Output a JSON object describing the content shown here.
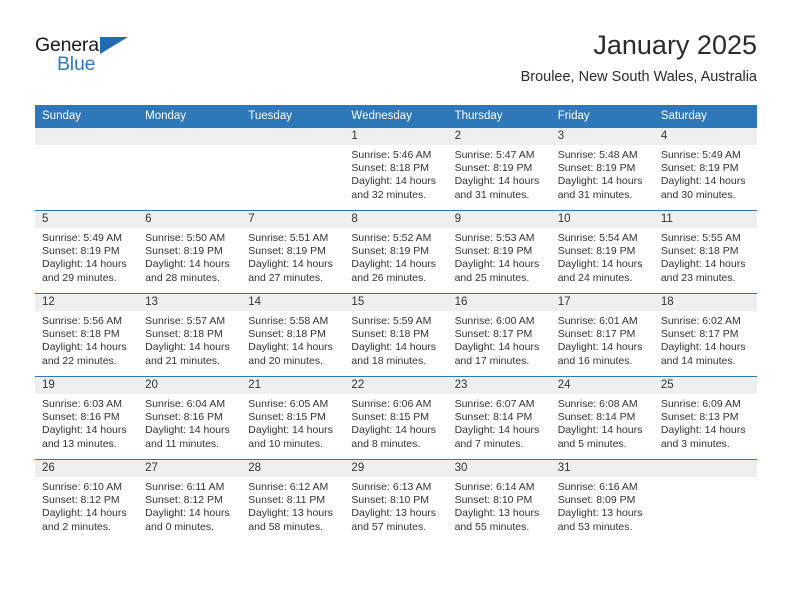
{
  "brand": {
    "name_part1": "General",
    "name_part2": "Blue",
    "triangle_color": "#1f6cb0",
    "blue_text_color": "#2e7ac4"
  },
  "header": {
    "title": "January 2025",
    "location": "Broulee, New South Wales, Australia"
  },
  "theme": {
    "header_blue": "#2e77b8",
    "daynum_band_gray": "#efefef",
    "text_color": "#333333"
  },
  "calendar": {
    "weekday_headers": [
      "Sunday",
      "Monday",
      "Tuesday",
      "Wednesday",
      "Thursday",
      "Friday",
      "Saturday"
    ],
    "weeks": [
      [
        {
          "empty": true
        },
        {
          "empty": true
        },
        {
          "empty": true
        },
        {
          "day": "1",
          "sunrise": "Sunrise: 5:46 AM",
          "sunset": "Sunset: 8:18 PM",
          "daylight": "Daylight: 14 hours and 32 minutes."
        },
        {
          "day": "2",
          "sunrise": "Sunrise: 5:47 AM",
          "sunset": "Sunset: 8:19 PM",
          "daylight": "Daylight: 14 hours and 31 minutes."
        },
        {
          "day": "3",
          "sunrise": "Sunrise: 5:48 AM",
          "sunset": "Sunset: 8:19 PM",
          "daylight": "Daylight: 14 hours and 31 minutes."
        },
        {
          "day": "4",
          "sunrise": "Sunrise: 5:49 AM",
          "sunset": "Sunset: 8:19 PM",
          "daylight": "Daylight: 14 hours and 30 minutes."
        }
      ],
      [
        {
          "day": "5",
          "sunrise": "Sunrise: 5:49 AM",
          "sunset": "Sunset: 8:19 PM",
          "daylight": "Daylight: 14 hours and 29 minutes."
        },
        {
          "day": "6",
          "sunrise": "Sunrise: 5:50 AM",
          "sunset": "Sunset: 8:19 PM",
          "daylight": "Daylight: 14 hours and 28 minutes."
        },
        {
          "day": "7",
          "sunrise": "Sunrise: 5:51 AM",
          "sunset": "Sunset: 8:19 PM",
          "daylight": "Daylight: 14 hours and 27 minutes."
        },
        {
          "day": "8",
          "sunrise": "Sunrise: 5:52 AM",
          "sunset": "Sunset: 8:19 PM",
          "daylight": "Daylight: 14 hours and 26 minutes."
        },
        {
          "day": "9",
          "sunrise": "Sunrise: 5:53 AM",
          "sunset": "Sunset: 8:19 PM",
          "daylight": "Daylight: 14 hours and 25 minutes."
        },
        {
          "day": "10",
          "sunrise": "Sunrise: 5:54 AM",
          "sunset": "Sunset: 8:19 PM",
          "daylight": "Daylight: 14 hours and 24 minutes."
        },
        {
          "day": "11",
          "sunrise": "Sunrise: 5:55 AM",
          "sunset": "Sunset: 8:18 PM",
          "daylight": "Daylight: 14 hours and 23 minutes."
        }
      ],
      [
        {
          "day": "12",
          "sunrise": "Sunrise: 5:56 AM",
          "sunset": "Sunset: 8:18 PM",
          "daylight": "Daylight: 14 hours and 22 minutes."
        },
        {
          "day": "13",
          "sunrise": "Sunrise: 5:57 AM",
          "sunset": "Sunset: 8:18 PM",
          "daylight": "Daylight: 14 hours and 21 minutes."
        },
        {
          "day": "14",
          "sunrise": "Sunrise: 5:58 AM",
          "sunset": "Sunset: 8:18 PM",
          "daylight": "Daylight: 14 hours and 20 minutes."
        },
        {
          "day": "15",
          "sunrise": "Sunrise: 5:59 AM",
          "sunset": "Sunset: 8:18 PM",
          "daylight": "Daylight: 14 hours and 18 minutes."
        },
        {
          "day": "16",
          "sunrise": "Sunrise: 6:00 AM",
          "sunset": "Sunset: 8:17 PM",
          "daylight": "Daylight: 14 hours and 17 minutes."
        },
        {
          "day": "17",
          "sunrise": "Sunrise: 6:01 AM",
          "sunset": "Sunset: 8:17 PM",
          "daylight": "Daylight: 14 hours and 16 minutes."
        },
        {
          "day": "18",
          "sunrise": "Sunrise: 6:02 AM",
          "sunset": "Sunset: 8:17 PM",
          "daylight": "Daylight: 14 hours and 14 minutes."
        }
      ],
      [
        {
          "day": "19",
          "sunrise": "Sunrise: 6:03 AM",
          "sunset": "Sunset: 8:16 PM",
          "daylight": "Daylight: 14 hours and 13 minutes."
        },
        {
          "day": "20",
          "sunrise": "Sunrise: 6:04 AM",
          "sunset": "Sunset: 8:16 PM",
          "daylight": "Daylight: 14 hours and 11 minutes."
        },
        {
          "day": "21",
          "sunrise": "Sunrise: 6:05 AM",
          "sunset": "Sunset: 8:15 PM",
          "daylight": "Daylight: 14 hours and 10 minutes."
        },
        {
          "day": "22",
          "sunrise": "Sunrise: 6:06 AM",
          "sunset": "Sunset: 8:15 PM",
          "daylight": "Daylight: 14 hours and 8 minutes."
        },
        {
          "day": "23",
          "sunrise": "Sunrise: 6:07 AM",
          "sunset": "Sunset: 8:14 PM",
          "daylight": "Daylight: 14 hours and 7 minutes."
        },
        {
          "day": "24",
          "sunrise": "Sunrise: 6:08 AM",
          "sunset": "Sunset: 8:14 PM",
          "daylight": "Daylight: 14 hours and 5 minutes."
        },
        {
          "day": "25",
          "sunrise": "Sunrise: 6:09 AM",
          "sunset": "Sunset: 8:13 PM",
          "daylight": "Daylight: 14 hours and 3 minutes."
        }
      ],
      [
        {
          "day": "26",
          "sunrise": "Sunrise: 6:10 AM",
          "sunset": "Sunset: 8:12 PM",
          "daylight": "Daylight: 14 hours and 2 minutes."
        },
        {
          "day": "27",
          "sunrise": "Sunrise: 6:11 AM",
          "sunset": "Sunset: 8:12 PM",
          "daylight": "Daylight: 14 hours and 0 minutes."
        },
        {
          "day": "28",
          "sunrise": "Sunrise: 6:12 AM",
          "sunset": "Sunset: 8:11 PM",
          "daylight": "Daylight: 13 hours and 58 minutes."
        },
        {
          "day": "29",
          "sunrise": "Sunrise: 6:13 AM",
          "sunset": "Sunset: 8:10 PM",
          "daylight": "Daylight: 13 hours and 57 minutes."
        },
        {
          "day": "30",
          "sunrise": "Sunrise: 6:14 AM",
          "sunset": "Sunset: 8:10 PM",
          "daylight": "Daylight: 13 hours and 55 minutes."
        },
        {
          "day": "31",
          "sunrise": "Sunrise: 6:16 AM",
          "sunset": "Sunset: 8:09 PM",
          "daylight": "Daylight: 13 hours and 53 minutes."
        },
        {
          "empty": true
        }
      ]
    ]
  }
}
